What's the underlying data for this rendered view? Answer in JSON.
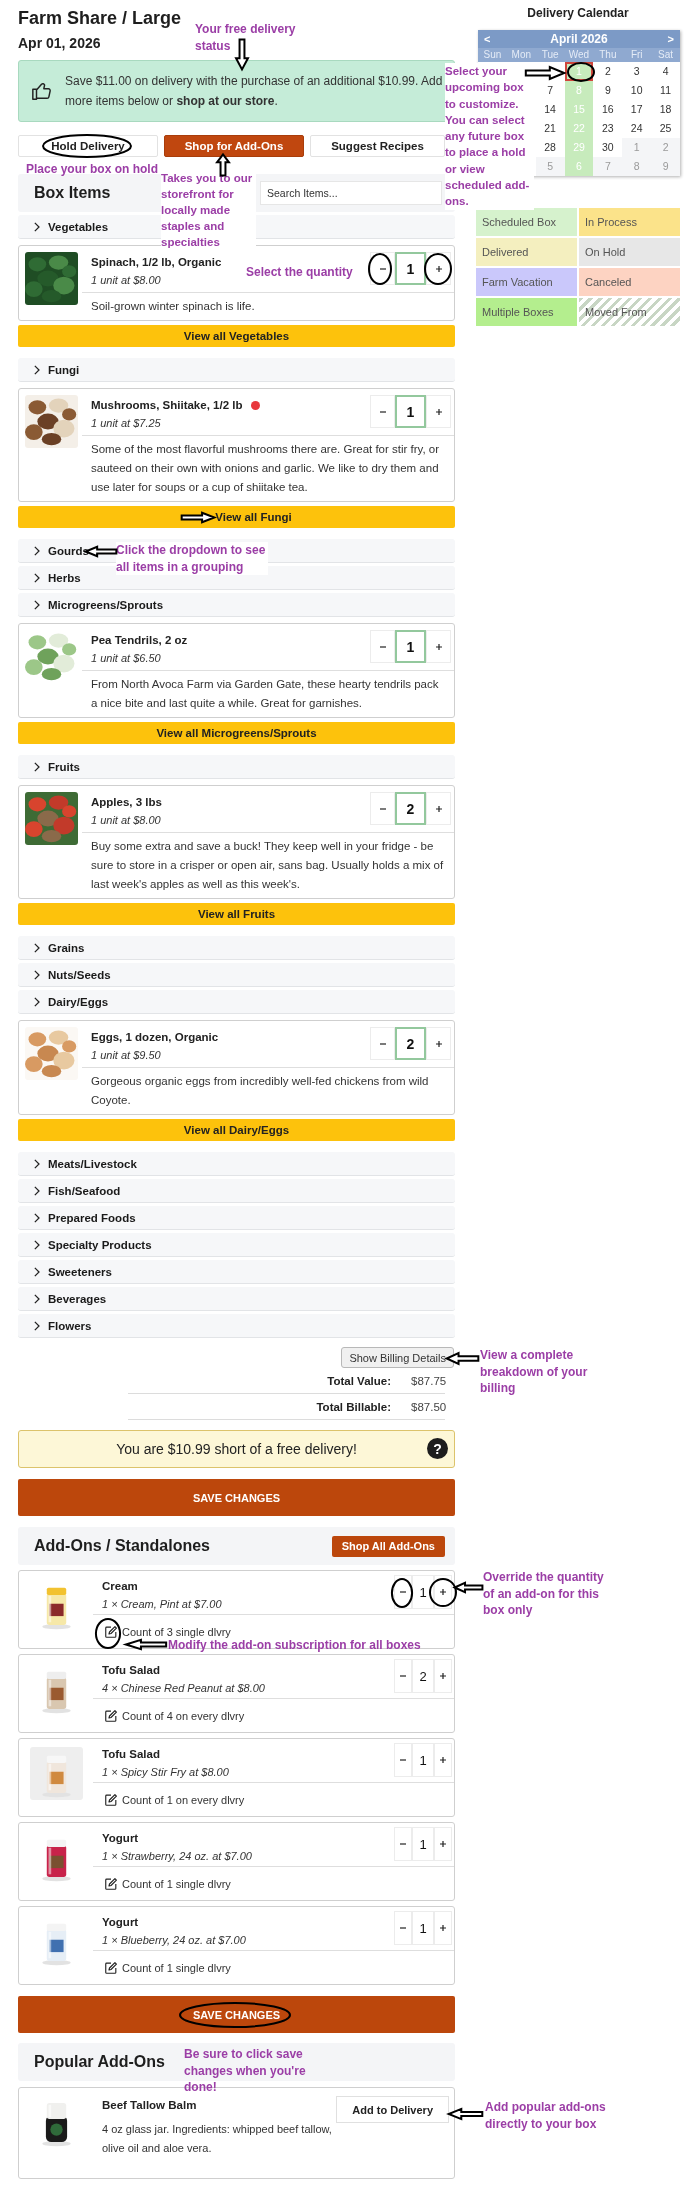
{
  "header": {
    "title": "Farm Share / Large",
    "date": "Apr 01, 2026",
    "note": "Your free delivery status"
  },
  "promo": {
    "text": "Save $11.00 on delivery with the purchase of an additional $10.99. Add more items below or **shop at our store**."
  },
  "actions": {
    "buttons": [
      {
        "label": "Hold Delivery",
        "kind": "outline"
      },
      {
        "label": "Shop for Add-Ons",
        "kind": "primary"
      },
      {
        "label": "Suggest Recipes",
        "kind": "outline"
      }
    ],
    "hold_note": "Place your box on hold",
    "shop_note": "Takes you to our storefront for locally made staples and specialties"
  },
  "box_items": {
    "title": "Box Items",
    "search": {
      "placeholder": "Search Items..."
    },
    "groups": [
      {
        "name": "Vegetables",
        "items": [
          {
            "name": "Spinach, 1/2 lb, Organic",
            "price": "1 unit at $8.00",
            "description": "Soil-grown winter spinach is life.",
            "quantity": "1",
            "flagged": false,
            "note": "Select the quantity"
          }
        ],
        "view_all": "View all Vegetables",
        "pointed": false
      },
      {
        "name": "Fungi",
        "items": [
          {
            "name": "Mushrooms, Shiitake, 1/2 lb",
            "price": "1 unit at $7.25",
            "description": "Some of the most flavorful mushrooms there are. Great for stir fry, or sauteed on their own with onions and garlic. We like to dry them and use later for soups or a cup of shiitake tea.",
            "quantity": "1",
            "flagged": true
          }
        ],
        "view_all": "View all Fungi",
        "pointed": true
      },
      {
        "name": "Gourds",
        "note": "Click the dropdown to see all items in a grouping"
      },
      {
        "name": "Herbs"
      },
      {
        "name": "Microgreens/Sprouts",
        "items": [
          {
            "name": "Pea Tendrils, 2 oz",
            "price": "1 unit at $6.50",
            "description": "From North Avoca Farm via Garden Gate, these hearty tendrils pack a nice bite and last quite a while. Great for garnishes.",
            "quantity": "1",
            "flagged": false
          }
        ],
        "view_all": "View all Microgreens/Sprouts",
        "pointed": false
      },
      {
        "name": "Fruits",
        "items": [
          {
            "name": "Apples, 3 lbs",
            "price": "1 unit at $8.00",
            "description": "Buy some extra and save a buck! They keep well in your fridge - be sure to store in a crisper or open air, sans bag. Usually holds a mix of last week's apples as well as this week's.",
            "quantity": "2",
            "flagged": false
          }
        ],
        "view_all": "View all Fruits",
        "pointed": false
      },
      {
        "name": "Grains"
      },
      {
        "name": "Nuts/Seeds"
      },
      {
        "name": "Dairy/Eggs",
        "items": [
          {
            "name": "Eggs, 1 dozen, Organic",
            "price": "1 unit at $9.50",
            "description": "Gorgeous organic eggs from incredibly well-fed chickens from wild Coyote.",
            "quantity": "2",
            "flagged": false
          }
        ],
        "view_all": "View all Dairy/Eggs",
        "pointed": false
      },
      {
        "name": "Meats/Livestock"
      },
      {
        "name": "Fish/Seafood"
      },
      {
        "name": "Prepared Foods"
      },
      {
        "name": "Specialty Products"
      },
      {
        "name": "Sweeteners"
      },
      {
        "name": "Beverages"
      },
      {
        "name": "Flowers"
      }
    ]
  },
  "totals": {
    "button": "Show Billing Details",
    "note": "View a complete breakdown of your billing",
    "rows": [
      {
        "label": "Total Value:",
        "value": "$87.75"
      },
      {
        "label": "Total Billable:",
        "value": "$87.50"
      }
    ]
  },
  "notice": {
    "text": "You are $10.99 short of a free delivery!",
    "help": "?"
  },
  "save_button": "SAVE CHANGES",
  "addons": {
    "title": "Add-Ons / Standalones",
    "shop_button": "Shop All Add-Ons",
    "items": [
      {
        "name": "Cream",
        "detail": "1 × Cream, Pint at $7.00",
        "quantity": "1",
        "subscription": "Count of 3 single dlvry",
        "quantity_note": "Override the quantity of an add-on for this box only",
        "subscription_note": "Modify the add-on subscription for all boxes"
      },
      {
        "name": "Tofu Salad",
        "detail": "4 × Chinese Red Peanut at $8.00",
        "quantity": "2",
        "subscription": "Count of 4 on every dlvry"
      },
      {
        "name": "Tofu Salad",
        "detail": "1 × Spicy Stir Fry at $8.00",
        "quantity": "1",
        "subscription": "Count of 1 on every dlvry"
      },
      {
        "name": "Yogurt",
        "detail": "1 × Strawberry, 24 oz. at $7.00",
        "quantity": "1",
        "subscription": "Count of 1 single dlvry"
      },
      {
        "name": "Yogurt",
        "detail": "1 × Blueberry, 24 oz. at $7.00",
        "quantity": "1",
        "subscription": "Count of 1 single dlvry"
      }
    ]
  },
  "footer": {
    "save_button": "SAVE CHANGES",
    "save_note": "Be sure to click save changes when you're done!"
  },
  "popular": {
    "title": "Popular Add-Ons",
    "items": [
      {
        "name": "Beef Tallow Balm",
        "description": "4 oz glass jar. Ingredients: whipped beef tallow, olive oil and aloe vera.",
        "button": "Add to Delivery",
        "note": "Add popular add-ons directly to your box"
      }
    ]
  },
  "calendar": {
    "title": "Delivery Calendar",
    "month": "April 2026",
    "prev": "<",
    "next": ">",
    "note": "Select your upcoming box to customize. You can select any future box to place a hold or view scheduled add-ons.",
    "weekdays": [
      "Sun",
      "Mon",
      "Tue",
      "Wed",
      "Thu",
      "Fri",
      "Sat"
    ],
    "weeks": [
      [
        {
          "day": "1",
          "scheduled": true,
          "selected": true,
          "outside": false
        },
        {
          "day": "2",
          "scheduled": false,
          "selected": false,
          "outside": false
        },
        {
          "day": "3",
          "scheduled": false,
          "selected": false,
          "outside": false
        },
        {
          "day": "4",
          "scheduled": false,
          "selected": false,
          "outside": false
        }
      ],
      [
        {
          "day": "7",
          "scheduled": false,
          "selected": false,
          "outside": false
        },
        {
          "day": "8",
          "scheduled": true,
          "selected": false,
          "outside": false
        },
        {
          "day": "9",
          "scheduled": false,
          "selected": false,
          "outside": false
        },
        {
          "day": "10",
          "scheduled": false,
          "selected": false,
          "outside": false
        },
        {
          "day": "11",
          "scheduled": false,
          "selected": false,
          "outside": false
        }
      ],
      [
        {
          "day": "14",
          "scheduled": false,
          "selected": false,
          "outside": false
        },
        {
          "day": "15",
          "scheduled": true,
          "selected": false,
          "outside": false
        },
        {
          "day": "16",
          "scheduled": false,
          "selected": false,
          "outside": false
        },
        {
          "day": "17",
          "scheduled": false,
          "selected": false,
          "outside": false
        },
        {
          "day": "18",
          "scheduled": false,
          "selected": false,
          "outside": false
        }
      ],
      [
        {
          "day": "21",
          "scheduled": false,
          "selected": false,
          "outside": false
        },
        {
          "day": "22",
          "scheduled": true,
          "selected": false,
          "outside": false
        },
        {
          "day": "23",
          "scheduled": false,
          "selected": false,
          "outside": false
        },
        {
          "day": "24",
          "scheduled": false,
          "selected": false,
          "outside": false
        },
        {
          "day": "25",
          "scheduled": false,
          "selected": false,
          "outside": false
        }
      ],
      [
        {
          "day": "28",
          "scheduled": false,
          "selected": false,
          "outside": false
        },
        {
          "day": "29",
          "scheduled": true,
          "selected": false,
          "outside": false
        },
        {
          "day": "30",
          "scheduled": false,
          "selected": false,
          "outside": false
        },
        {
          "day": "1",
          "scheduled": false,
          "selected": false,
          "outside": true
        },
        {
          "day": "2",
          "scheduled": false,
          "selected": false,
          "outside": true
        }
      ],
      [
        {
          "day": "5",
          "scheduled": false,
          "selected": false,
          "outside": true
        },
        {
          "day": "6",
          "scheduled": true,
          "selected": false,
          "outside": true
        },
        {
          "day": "7",
          "scheduled": false,
          "selected": false,
          "outside": true
        },
        {
          "day": "8",
          "scheduled": false,
          "selected": false,
          "outside": true
        },
        {
          "day": "9",
          "scheduled": false,
          "selected": false,
          "outside": true
        }
      ]
    ]
  },
  "legend": [
    {
      "label": "Scheduled Box",
      "color": "#d6f2cd",
      "kind": "solid"
    },
    {
      "label": "In Process",
      "color": "#fbe38a",
      "kind": "solid"
    },
    {
      "label": "Delivered",
      "color": "#f4efbf",
      "kind": "solid"
    },
    {
      "label": "On Hold",
      "color": "#e7e7e7",
      "kind": "solid"
    },
    {
      "label": "Farm Vacation",
      "color": "#cac8fb",
      "kind": "solid"
    },
    {
      "label": "Canceled",
      "color": "#fdd3c2",
      "kind": "solid"
    },
    {
      "label": "Multiple Boxes",
      "color": "#b4ee8e",
      "kind": "solid"
    },
    {
      "label": "Moved From",
      "color": "#c8d6c4",
      "kind": "hatched"
    }
  ]
}
